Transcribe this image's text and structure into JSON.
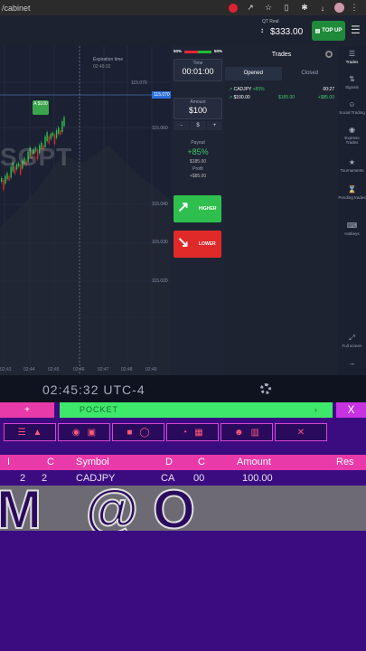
{
  "browser": {
    "url": "/cabinet",
    "icons": [
      "shield-icon",
      "share-icon",
      "star-icon",
      "sidebar-icon",
      "extensions-icon",
      "download-icon",
      "menu-icon"
    ]
  },
  "header": {
    "account_type": "QT Real",
    "balance": "$333.00",
    "topup_label": "TOP UP"
  },
  "chart": {
    "watermark": "SGPT",
    "expiration_label": "Expiration time",
    "expiration_time": "02:49:32",
    "current_price": "115.070",
    "trade_marker": "A $100",
    "price_labels": [
      "115.070",
      "115.060",
      "115.040",
      "115.030",
      "115.020"
    ],
    "time_ticks": [
      "02:43",
      "02:44",
      "02:45",
      "02:46",
      "02:47",
      "02:48",
      "02:49"
    ]
  },
  "controls": {
    "sentiment_left": "50%",
    "sentiment_right": "50%",
    "time_caption": "Time",
    "time_value": "00:01:00",
    "amount_caption": "Amount",
    "amount_value": "$100",
    "minus": "-",
    "plus": "+",
    "currency": "$",
    "payout_caption": "Payout",
    "payout_pct": "+85%",
    "payout_amount": "$185.00",
    "profit_caption": "Profit",
    "profit_value": "+$85.00",
    "higher_label": "HIGHER",
    "lower_label": "LOWER"
  },
  "trades": {
    "title": "Trades",
    "tabs": [
      "Opened",
      "Closed"
    ],
    "rows": [
      {
        "pair": "CADJPY",
        "pct": "+85%",
        "time": "00:27",
        "stake": "$100.00",
        "mid": "$185.00",
        "profit": "+$85.00"
      }
    ]
  },
  "sidebar": {
    "items": [
      {
        "label": "Trades",
        "icon": "trades-icon"
      },
      {
        "label": "Signals",
        "icon": "signals-icon"
      },
      {
        "label": "Social Trading",
        "icon": "social-icon"
      },
      {
        "label": "Express Trades",
        "icon": "express-icon"
      },
      {
        "label": "Tournaments",
        "icon": "trophy-icon"
      },
      {
        "label": "Pending trades",
        "icon": "pending-icon"
      },
      {
        "label": "Hotkeys",
        "icon": "hotkeys-icon"
      },
      {
        "label": "Full screen",
        "icon": "fullscreen-icon"
      }
    ]
  },
  "clock": {
    "time": "02:45:32 UTC-4"
  },
  "bot": {
    "add_label": "+",
    "pocket_label": "POCKET",
    "close_label": "X",
    "table_headers": [
      "I",
      "C",
      "Symbol",
      "D",
      "C",
      "Amount",
      "Res"
    ],
    "table_row": [
      "2",
      "2",
      "CADJPY",
      "CA",
      "00",
      "100.00"
    ],
    "big_text": "M @O"
  },
  "colors": {
    "accent_green": "#2fbf4f",
    "accent_red": "#e02a2a",
    "bot_bg": "#3b0c80",
    "bot_pink": "#e83aa8",
    "bot_green": "#3ee86a"
  }
}
